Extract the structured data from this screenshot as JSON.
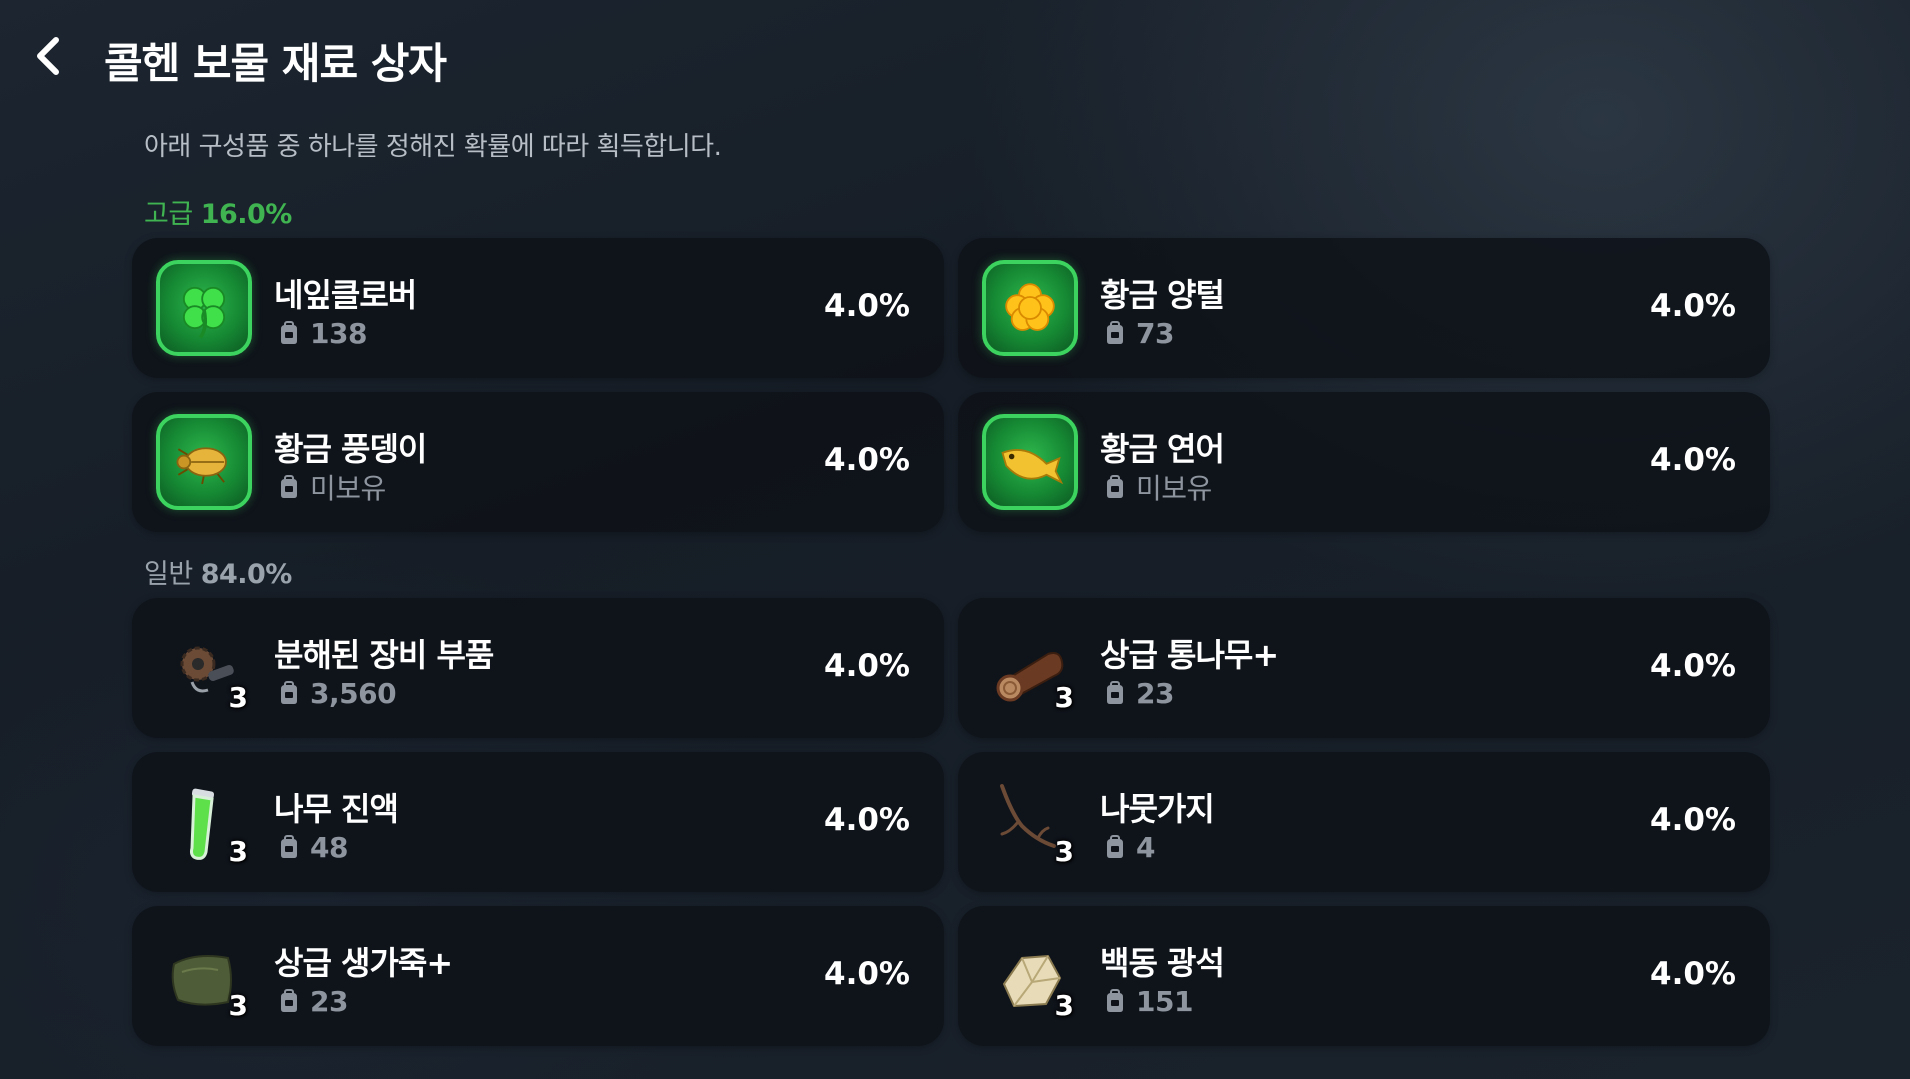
{
  "header": {
    "title": "콜헨 보물 재료 상자"
  },
  "subtitle": "아래 구성품 중 하나를 정해진 확률에 따라 획득합니다.",
  "sections": {
    "high": {
      "name": "고급",
      "pct": "16.0%",
      "color": "#3fb450"
    },
    "normal": {
      "name": "일반",
      "pct": "84.0%",
      "color": "#9aa2ac"
    }
  },
  "items": [
    {
      "name": "네잎클로버",
      "owned": "138",
      "rate": "4.0%",
      "icon": "clover-icon",
      "tier": "high"
    },
    {
      "name": "황금 양털",
      "owned": "73",
      "rate": "4.0%",
      "icon": "golden-wool-icon",
      "tier": "high"
    },
    {
      "name": "황금 풍뎅이",
      "owned": "미보유",
      "rate": "4.0%",
      "icon": "golden-beetle-icon",
      "tier": "high"
    },
    {
      "name": "황금 연어",
      "owned": "미보유",
      "rate": "4.0%",
      "icon": "golden-salmon-icon",
      "tier": "high"
    },
    {
      "name": "분해된 장비 부품",
      "owned": "3,560",
      "rate": "4.0%",
      "qty": "3",
      "icon": "gear-parts-icon",
      "tier": "normal"
    },
    {
      "name": "상급 통나무+",
      "owned": "23",
      "rate": "4.0%",
      "qty": "3",
      "icon": "log-icon",
      "tier": "normal"
    },
    {
      "name": "나무 진액",
      "owned": "48",
      "rate": "4.0%",
      "qty": "3",
      "icon": "sap-vial-icon",
      "tier": "normal"
    },
    {
      "name": "나뭇가지",
      "owned": "4",
      "rate": "4.0%",
      "qty": "3",
      "icon": "twig-icon",
      "tier": "normal"
    },
    {
      "name": "상급 생가죽+",
      "owned": "23",
      "rate": "4.0%",
      "qty": "3",
      "icon": "rawhide-icon",
      "tier": "normal"
    },
    {
      "name": "백동 광석",
      "owned": "151",
      "rate": "4.0%",
      "qty": "3",
      "icon": "ore-icon",
      "tier": "normal"
    }
  ]
}
